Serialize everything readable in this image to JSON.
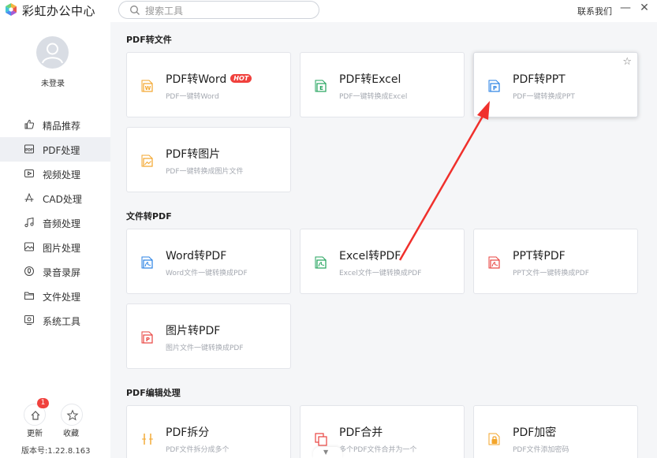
{
  "app": {
    "title": "彩虹办公中心",
    "search_placeholder": "搜索工具",
    "contact": "联系我们",
    "minimize": "—",
    "close": "✕"
  },
  "sidebar": {
    "user": "未登录",
    "items": [
      {
        "label": "精品推荐",
        "icon": "thumb-up-icon"
      },
      {
        "label": "PDF处理",
        "icon": "pdf-icon"
      },
      {
        "label": "视频处理",
        "icon": "video-icon"
      },
      {
        "label": "CAD处理",
        "icon": "cad-icon"
      },
      {
        "label": "音频处理",
        "icon": "music-icon"
      },
      {
        "label": "图片处理",
        "icon": "image-icon"
      },
      {
        "label": "录音录屏",
        "icon": "record-icon"
      },
      {
        "label": "文件处理",
        "icon": "folder-icon"
      },
      {
        "label": "系统工具",
        "icon": "system-icon"
      }
    ],
    "update_label": "更新",
    "update_badge": "1",
    "favorite_label": "收藏",
    "version": "版本号:1.22.8.163"
  },
  "sections": [
    {
      "title": "PDF转文件",
      "cards": [
        {
          "title": "PDF转Word",
          "desc": "PDF一键转Word",
          "hot": "HOT",
          "icon": "word-doc-icon",
          "color": "#f3a52b"
        },
        {
          "title": "PDF转Excel",
          "desc": "PDF一键转换成Excel",
          "icon": "excel-doc-icon",
          "color": "#23a35c"
        },
        {
          "title": "PDF转PPT",
          "desc": "PDF一键转换成PPT",
          "icon": "ppt-doc-icon",
          "color": "#2a82e4"
        },
        {
          "title": "PDF转图片",
          "desc": "PDF一键转换成图片文件",
          "icon": "image-doc-icon",
          "color": "#f3a52b"
        }
      ]
    },
    {
      "title": "文件转PDF",
      "cards": [
        {
          "title": "Word转PDF",
          "desc": "Word文件一键转换成PDF",
          "icon": "word-to-pdf-icon",
          "color": "#2a82e4"
        },
        {
          "title": "Excel转PDF",
          "desc": "Excel文件一键转换成PDF",
          "icon": "excel-to-pdf-icon",
          "color": "#23a35c"
        },
        {
          "title": "PPT转PDF",
          "desc": "PPT文件一键转换成PDF",
          "icon": "ppt-to-pdf-icon",
          "color": "#e8433f"
        },
        {
          "title": "图片转PDF",
          "desc": "图片文件一键转换成PDF",
          "icon": "image-to-pdf-icon",
          "color": "#e8433f"
        }
      ]
    },
    {
      "title": "PDF编辑处理",
      "cards": [
        {
          "title": "PDF拆分",
          "desc": "PDF文件拆分成多个",
          "icon": "split-icon",
          "color": "#f3a52b"
        },
        {
          "title": "PDF合并",
          "desc": "多个PDF文件合并为一个",
          "icon": "merge-icon",
          "color": "#e8433f"
        },
        {
          "title": "PDF加密",
          "desc": "PDF文件添加密码",
          "icon": "lock-icon",
          "color": "#f3a52b"
        }
      ]
    }
  ],
  "colors": {
    "accent_red": "#f0413d",
    "arrow": "#f0302c"
  }
}
